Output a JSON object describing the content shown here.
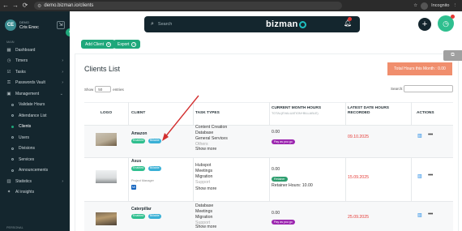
{
  "browser": {
    "url": "demo.bizman.io/clients",
    "profile_label": "Incognito"
  },
  "sidebar": {
    "avatar_initials": "CE",
    "profile_small": "DEMO",
    "profile_name": "Cris Enoc",
    "section_main": "MAIN",
    "items": {
      "dashboard": "Dashboard",
      "timers": "Timers",
      "tasks": "Tasks",
      "passwords": "Passwords Vault",
      "management": "Management",
      "validate_hours": "Validate Hours",
      "attendance": "Attendance List",
      "clients": "Clients",
      "users": "Users",
      "divisions": "Divisions",
      "services": "Services",
      "announcements": "Announcements",
      "statistics": "Statistics",
      "ai_insights": "AI insights"
    },
    "section_bottom": "PERSONAL"
  },
  "header": {
    "search_placeholder": "Search",
    "brand": "bizman"
  },
  "toolbar": {
    "add_client": "Add Client",
    "export": "Export"
  },
  "page": {
    "title": "Clients List",
    "total_hours": "Total Hours this Month : 0.00",
    "show_label": "Show",
    "entries_value": "50",
    "entries_label": "entries",
    "search_label": "Search:"
  },
  "table": {
    "headers": {
      "logo": "LOGO",
      "client": "CLIENT",
      "task_types": "TASK TYPES",
      "current_hours": "CURRENT MONTH HOURS",
      "current_hours_sub": "TOTAL(EVALUATION+BILLABLE)",
      "latest_date": "LATEST DATE HOURS",
      "latest_date2": "RECORDED",
      "actions": "ACTIONS"
    },
    "rows": [
      {
        "client": "Amazon",
        "badges": [
          "Enabled",
          "Billable"
        ],
        "tasks": [
          "Content Creation",
          "Database",
          "General Services",
          "Others"
        ],
        "show_more": "Show more",
        "hours": "0.00",
        "hours_badge": "Pay as you go",
        "date": "09.10.2025"
      },
      {
        "client": "Asus",
        "badges": [
          "Enabled",
          "Billable"
        ],
        "project_manager_label": "Project Manager",
        "pm_initials": "MI",
        "tasks": [
          "Hubspot",
          "Meetings",
          "Migration",
          "Support"
        ],
        "show_more": "Show more",
        "hours": "0.00",
        "hours_badge": "Retainer",
        "retainer": "Retainer Hours: 10.00",
        "date": "15.09.2025"
      },
      {
        "client": "Caterpillar",
        "badges": [
          "Enabled",
          "Billable"
        ],
        "tasks": [
          "Database",
          "Meetings",
          "Migration",
          "Support"
        ],
        "show_more": "Show more",
        "hours": "0.00",
        "hours_badge": "Pay as you go",
        "date": "25.09.2025"
      }
    ]
  },
  "colors": {
    "sidebar_bg": "#14262e",
    "accent_green": "#1fa87b",
    "total_orange": "#f08e6d",
    "date_red": "#e53935",
    "annotation_arrow": "#d32f2f"
  }
}
